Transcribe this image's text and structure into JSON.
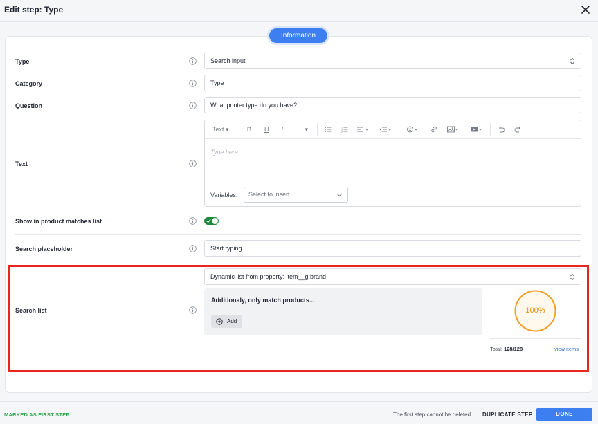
{
  "header": {
    "title": "Edit step: Type"
  },
  "section": {
    "tab_label": "Information"
  },
  "fields": {
    "type": {
      "label": "Type",
      "value": "Search input"
    },
    "category": {
      "label": "Category",
      "value": "Type"
    },
    "question": {
      "label": "Question",
      "value": "What printer type do you have?"
    },
    "text": {
      "label": "Text",
      "placeholder": "Type here..."
    },
    "show_in_matches": {
      "label": "Show in product matches list",
      "enabled": true
    },
    "search_placeholder": {
      "label": "Search placeholder",
      "value": "Start typing..."
    },
    "search_list": {
      "label": "Search list",
      "value": "Dynamic list from property: item__g:brand"
    }
  },
  "editor": {
    "text_style_label": "Text",
    "more_label": "···",
    "variables_label": "Variables:",
    "variables_placeholder": "Select to insert"
  },
  "filter": {
    "title": "Additionaly, only match products...",
    "add_label": "Add"
  },
  "stats": {
    "progress_text": "100%",
    "progress_fraction": 1.0,
    "total_label": "Total:",
    "total_value": "128/128",
    "view_items_label": "view items"
  },
  "footer": {
    "first_step_label": "MARKED AS FIRST STEP.",
    "note": "The first step cannot be deleted.",
    "duplicate_label": "DUPLICATE STEP",
    "done_label": "DONE"
  },
  "colors": {
    "accent": "#3d7ff0",
    "toggle_on": "#1a8a3a",
    "highlight": "#e8261d",
    "progress": "#f0a02a",
    "success": "#2fa24a"
  }
}
